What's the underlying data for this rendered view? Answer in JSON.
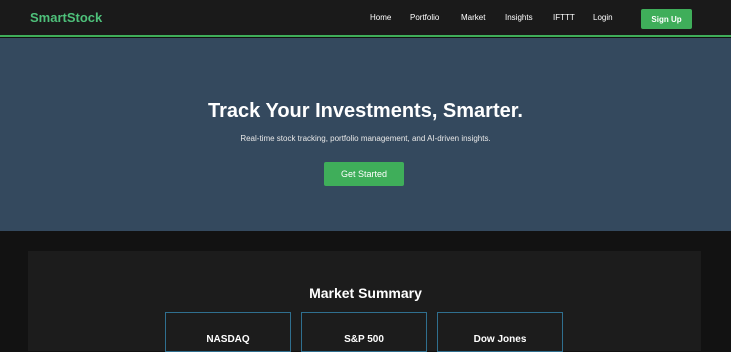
{
  "nav": {
    "brand": "SmartStock",
    "links": [
      "Home",
      "Portfolio",
      "Market",
      "Insights",
      "IFTTT",
      "Login"
    ],
    "signup": "Sign Up"
  },
  "hero": {
    "title": "Track Your Investments, Smarter.",
    "subtitle": "Real-time stock tracking, portfolio management, and AI-driven insights.",
    "cta": "Get Started"
  },
  "market_summary": {
    "title": "Market Summary",
    "indices": [
      "NASDAQ",
      "S&P 500",
      "Dow Jones"
    ]
  },
  "colors": {
    "accent": "#3fae5a",
    "hero_bg": "#34495e",
    "page_bg": "#121212",
    "card_border": "#2f6f8f"
  }
}
